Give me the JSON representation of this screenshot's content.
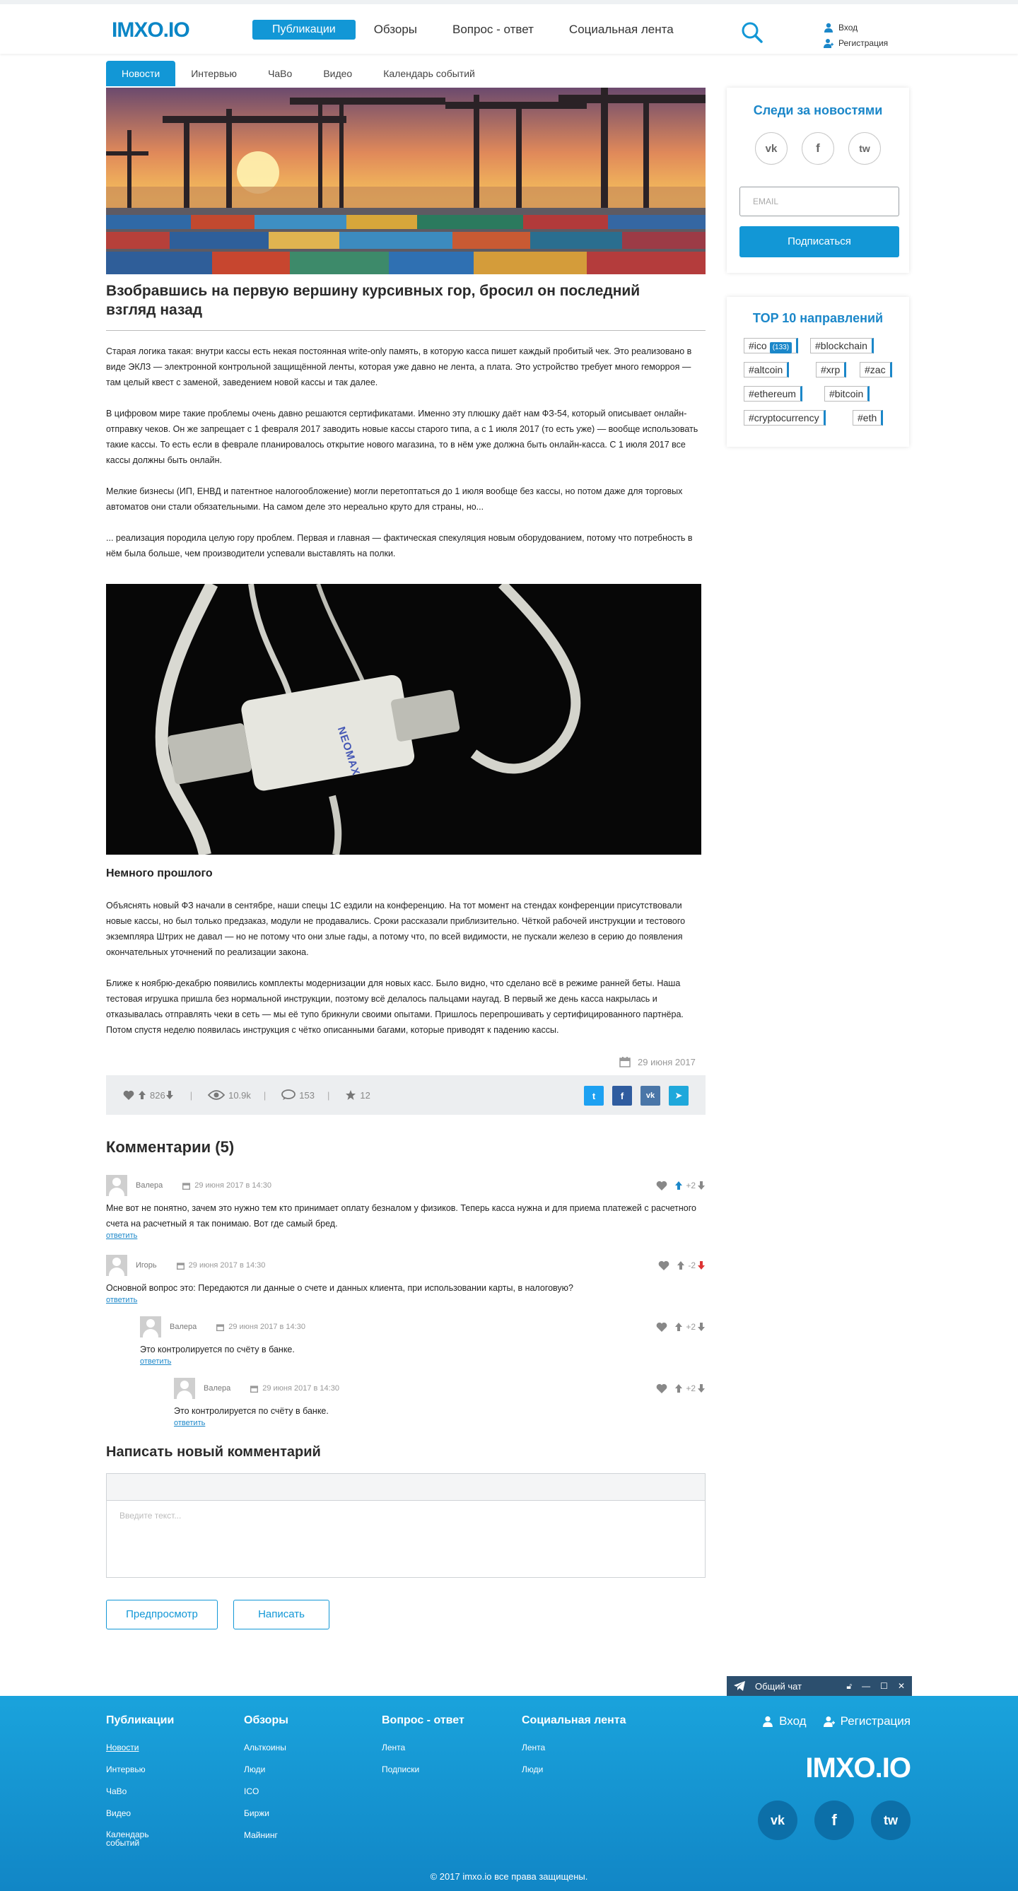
{
  "header": {
    "logo": "IMXO.IO",
    "nav": [
      "Публикации",
      "Обзоры",
      "Вопрос - ответ",
      "Социальная лента"
    ],
    "login": "Вход",
    "register": "Регистрация"
  },
  "subtabs": [
    "Новости",
    "Интервью",
    "ЧаВо",
    "Видео",
    "Календарь событий"
  ],
  "article": {
    "title": "Взобравшись на первую вершину курсивных гор, бросил он последний взгляд назад",
    "p1": "Старая логика такая: внутри кассы есть некая постоянная write-only память, в которую касса пишет каждый пробитый чек. Это реализовано в виде ЭКЛЗ — электронной контрольной защищённой ленты, которая уже давно не лента, а плата. Это устройство требует много геморроя — там целый квест с заменой, заведением новой кассы и так далее.",
    "p2": "В цифровом мире такие проблемы очень давно решаются сертификатами. Именно эту плюшку даёт нам ФЗ-54, который описывает онлайн-отправку чеков. Он же запрещает с 1 февраля 2017 заводить новые кассы старого типа, а с 1 июля 2017 (то есть уже) — вообще использовать такие кассы. То есть если в феврале планировалось открытие нового магазина, то в нём уже должна быть онлайн-касса. С 1 июля 2017 все кассы должны быть онлайн.",
    "p3": "Мелкие бизнесы (ИП, ЕНВД и патентное налогообложение) могли перетоптаться до 1 июля вообще без кассы, но потом даже для торговых автоматов они стали обязательными. На самом деле это нереально круто для страны, но...",
    "p4": "... реализация породила целую гору проблем. Первая и главная — фактическая спекуляция новым оборудованием, потому что потребность в нём была больше, чем производители успевали выставлять на полки.",
    "subheading": "Немного прошлого",
    "p5": "Объяснять новый ФЗ начали в сентябре, наши спецы 1С ездили на конференцию. На тот момент на стендах конференции присутствовали новые кассы, но был только предзаказ, модули не продавались. Сроки рассказали приблизительно. Чёткой рабочей инструкции и тестового экземпляра Штрих не давал — но не потому что они злые гады, а потому что, по всей видимости, не пускали железо в серию до появления окончательных уточнений по реализации закона.",
    "p6": "Ближе к ноябрю-декабрю появились комплекты модернизации для новых касс. Было видно, что сделано всё в режиме ранней беты. Наша тестовая игрушка пришла без нормальной инструкции, поэтому всё делалось пальцами наугад. В первый же день касса накрылась и отказывалась отправлять чеки в сеть — мы её тупо брикнули своими опытами. Пришлось перепрошивать у сертифицированного партнёра. Потом спустя неделю появилась инструкция с чётко описанными багами, которые приводят к падению кассы.",
    "date": "29 июня 2017",
    "device_label": "NEOMAX"
  },
  "stats": {
    "votes": "826",
    "views": "10.9k",
    "comments": "153",
    "favorites": "12"
  },
  "share": {
    "twitter": "t",
    "facebook": "f",
    "vk": "vk",
    "telegram": "➤"
  },
  "comments": {
    "title": "Комментарии (5)",
    "reply_label": "ответить",
    "items": [
      {
        "author": "Валера",
        "date": "29 июня 2017 в 14:30",
        "score": "+2",
        "text": "Мне вот не понятно, зачем это нужно тем кто принимает оплату безналом у физиков. Теперь касса нужна и для приема платежей с расчетного счета на расчетный я так понимаю. Вот где самый бред."
      },
      {
        "author": "Игорь",
        "date": "29 июня 2017 в 14:30",
        "score": "-2",
        "text": "Основной вопрос это: Передаются ли данные о счете и данных клиента, при использовании карты, в налоговую?"
      },
      {
        "author": "Валера",
        "date": "29 июня 2017 в 14:30",
        "score": "+2",
        "text": "Это контролируется по счёту в банке."
      },
      {
        "author": "Валера",
        "date": "29 июня 2017 в 14:30",
        "score": "+2",
        "text": "Это контролируется по счёту в банке."
      }
    ]
  },
  "new_comment": {
    "title": "Написать новый комментарий",
    "placeholder": "Введите текст...",
    "preview_button": "Предпросмотр",
    "submit_button": "Написать"
  },
  "sidebar": {
    "follow_title": "Следи за новостями",
    "social": [
      "vk",
      "f",
      "tw"
    ],
    "email_placeholder": "EMAIL",
    "subscribe_button": "Подписаться",
    "top_title": "TOP 10 направлений",
    "tags": [
      {
        "label": "#ico",
        "count": "(133)"
      },
      {
        "label": "#blockchain"
      },
      {
        "label": "#altcoin"
      },
      {
        "label": "#xrp"
      },
      {
        "label": "#zac"
      },
      {
        "label": "#ethereum"
      },
      {
        "label": "#bitcoin"
      },
      {
        "label": "#cryptocurrency"
      },
      {
        "label": "#eth"
      }
    ]
  },
  "chat": {
    "title": "Общий чат"
  },
  "footer": {
    "columns": [
      {
        "title": "Публикации",
        "links": [
          "Новости",
          "Интервью",
          "ЧаВо",
          "Видео",
          "Календарь событий"
        ]
      },
      {
        "title": "Обзоры",
        "links": [
          "Альткоины",
          "Люди",
          "ICO",
          "Биржи",
          "Майнинг"
        ]
      },
      {
        "title": "Вопрос - ответ",
        "links": [
          "Лента",
          "Подписки"
        ]
      },
      {
        "title": "Социальная лента",
        "links": [
          "Лента",
          "Люди"
        ]
      }
    ],
    "login": "Вход",
    "register": "Регистрация",
    "logo": "IMXO.IO",
    "social": [
      "vk",
      "f",
      "tw"
    ],
    "copyright": "© 2017 imxo.io все права защищены."
  },
  "colors": {
    "accent": "#1297d6",
    "accent_dark": "#1b87c9",
    "footer": "#1186c6",
    "chat": "#2c4f6e"
  }
}
